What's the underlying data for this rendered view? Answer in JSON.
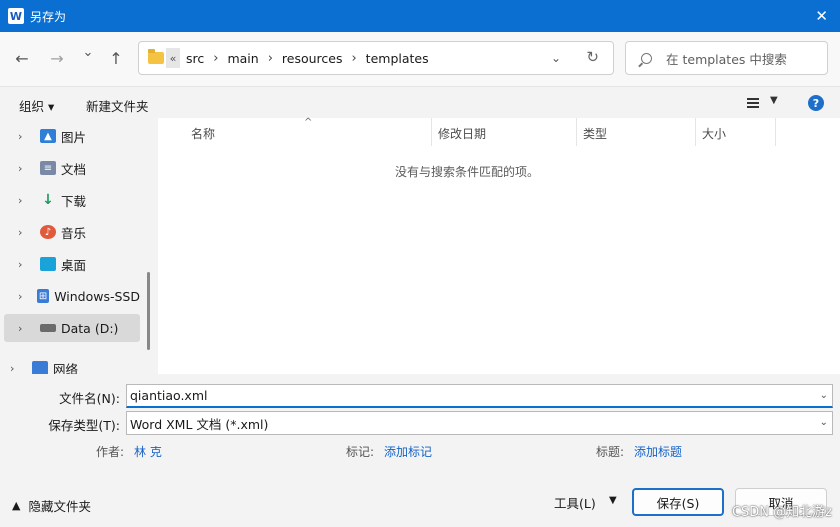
{
  "titlebar": {
    "app_icon": "W",
    "title": "另存为",
    "close": "✕"
  },
  "nav": {
    "back": "←",
    "forward": "→",
    "recent": "⌄",
    "up": "↑"
  },
  "address": {
    "overflow": "«",
    "crumbs": [
      "src",
      "main",
      "resources",
      "templates"
    ],
    "separator": "›",
    "dropdown": "⌄",
    "refresh": "↻"
  },
  "search": {
    "placeholder": "在 templates 中搜索"
  },
  "toolbar": {
    "organize": "组织 ▾",
    "new_folder": "新建文件夹",
    "view_dropdown": "▼",
    "help": "?"
  },
  "sidebar": {
    "items": [
      {
        "label": "图片",
        "icon": "pictures-icon",
        "color": "#2f7ed8"
      },
      {
        "label": "文档",
        "icon": "documents-icon",
        "color": "#7a8aa6"
      },
      {
        "label": "下载",
        "icon": "downloads-icon",
        "color": "#1b9a5c"
      },
      {
        "label": "音乐",
        "icon": "music-icon",
        "color": "#e05a3c"
      },
      {
        "label": "桌面",
        "icon": "desktop-icon",
        "color": "#1aa3d8"
      },
      {
        "label": "Windows-SSD",
        "icon": "windows-drive-icon",
        "color": "#3a7bd5"
      },
      {
        "label": "Data (D:)",
        "icon": "data-drive-icon",
        "color": "#6b6b6b"
      },
      {
        "label": "网络",
        "icon": "network-icon",
        "color": "#3a7bd5"
      }
    ]
  },
  "columns": {
    "name": "名称",
    "modified": "修改日期",
    "type": "类型",
    "size": "大小",
    "sort_indicator": "^"
  },
  "content": {
    "empty": "没有与搜索条件匹配的项。"
  },
  "form": {
    "filename_label": "文件名(N):",
    "filename_value": "qiantiao.xml",
    "filetype_label": "保存类型(T):",
    "filetype_value": "Word XML 文档 (*.xml)",
    "author_label": "作者:",
    "author_value": "林 克",
    "tags_label": "标记:",
    "tags_value": "添加标记",
    "title_label": "标题:",
    "title_value": "添加标题"
  },
  "footer": {
    "hide_folders": "隐藏文件夹",
    "tools": "工具(L)",
    "save": "保存(S)",
    "cancel": "取消",
    "watermark": "CSDN @知北游z"
  }
}
